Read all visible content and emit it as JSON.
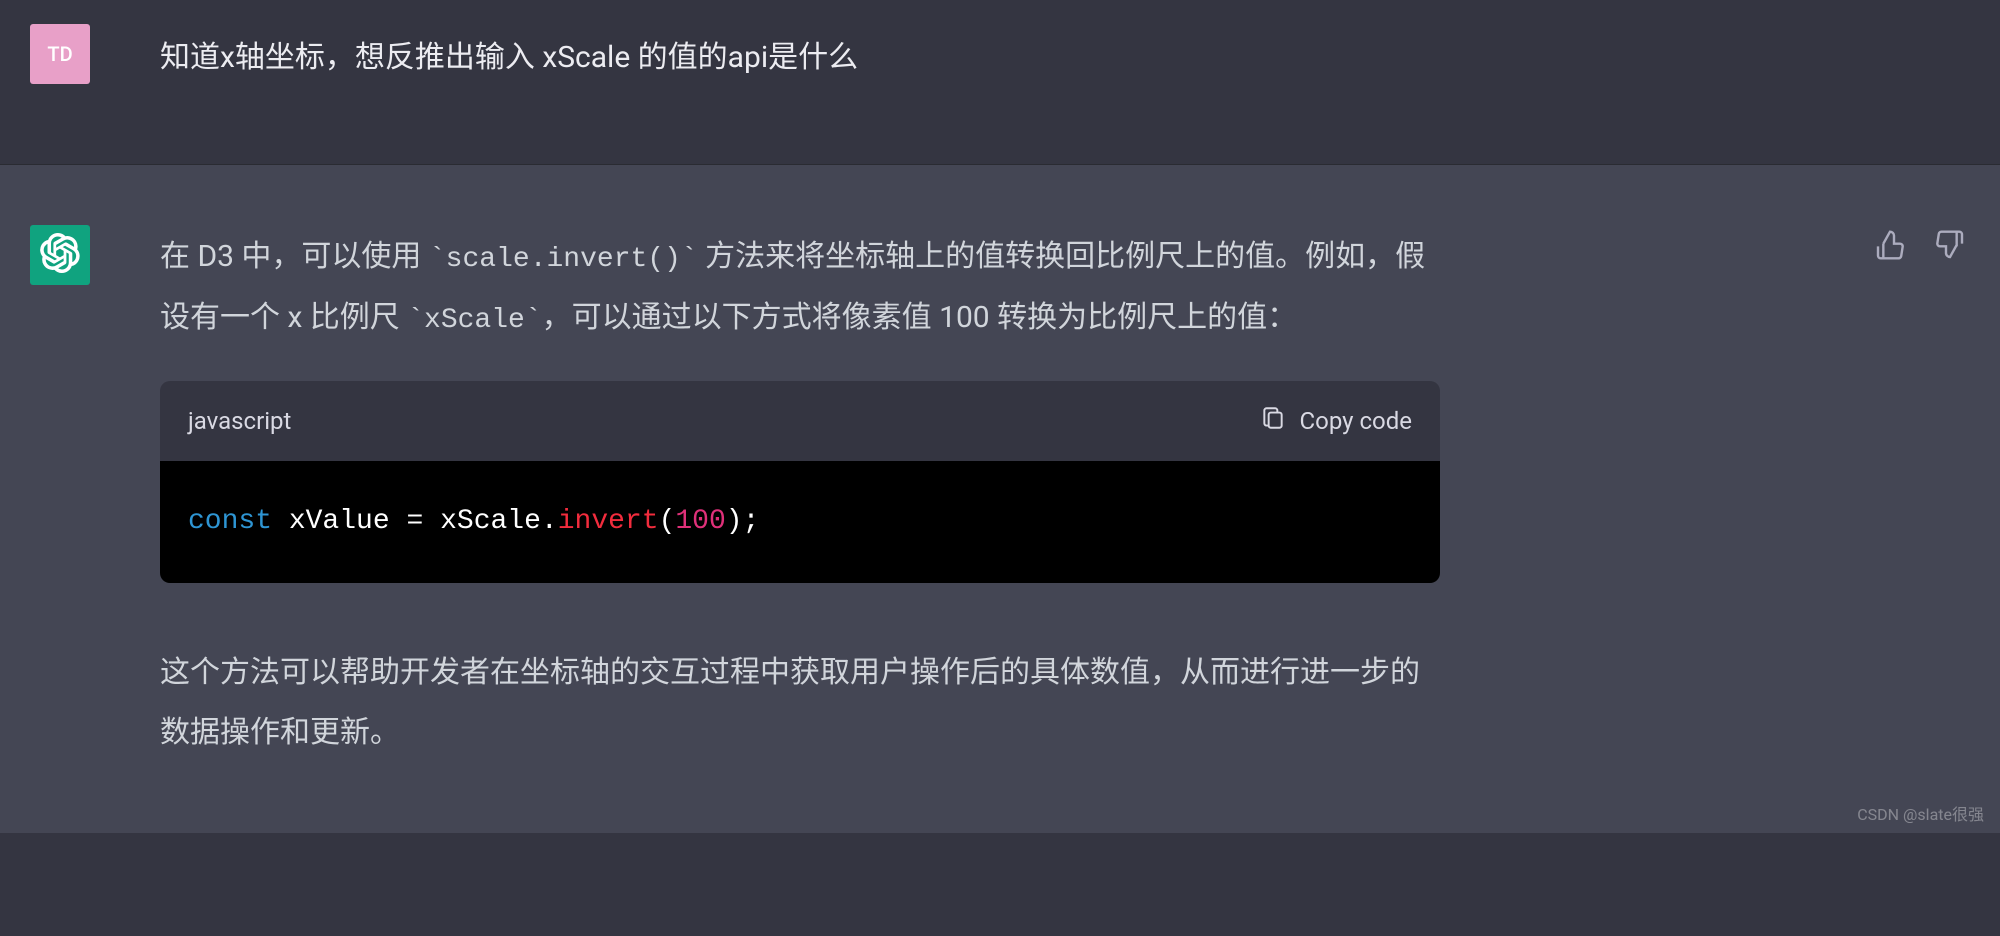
{
  "user": {
    "avatar_initials": "TD",
    "message": "知道x轴坐标，想反推出输入 xScale 的值的api是什么"
  },
  "assistant": {
    "para1_pre": "在 D3 中，可以使用 ",
    "para1_code": "`scale.invert()`",
    "para1_mid": " 方法来将坐标轴上的值转换回比例尺上的值。例如，假设有一个 x 比例尺 ",
    "para1_code2": "`xScale`",
    "para1_post": "，可以通过以下方式将像素值 100 转换为比例尺上的值：",
    "code": {
      "language": "javascript",
      "copy_label": "Copy code",
      "tokens": {
        "keyword": "const",
        "space1": " ",
        "varname": "xValue",
        "space2": " ",
        "equals": "=",
        "space3": " ",
        "scalevar": "xScale",
        "dot": ".",
        "method": "invert",
        "lparen": "(",
        "number": "100",
        "rparen": ")",
        "semi": ";"
      }
    },
    "para2": "这个方法可以帮助开发者在坐标轴的交互过程中获取用户操作后的具体数值，从而进行进一步的数据操作和更新。"
  },
  "watermark": "CSDN @slate很强"
}
